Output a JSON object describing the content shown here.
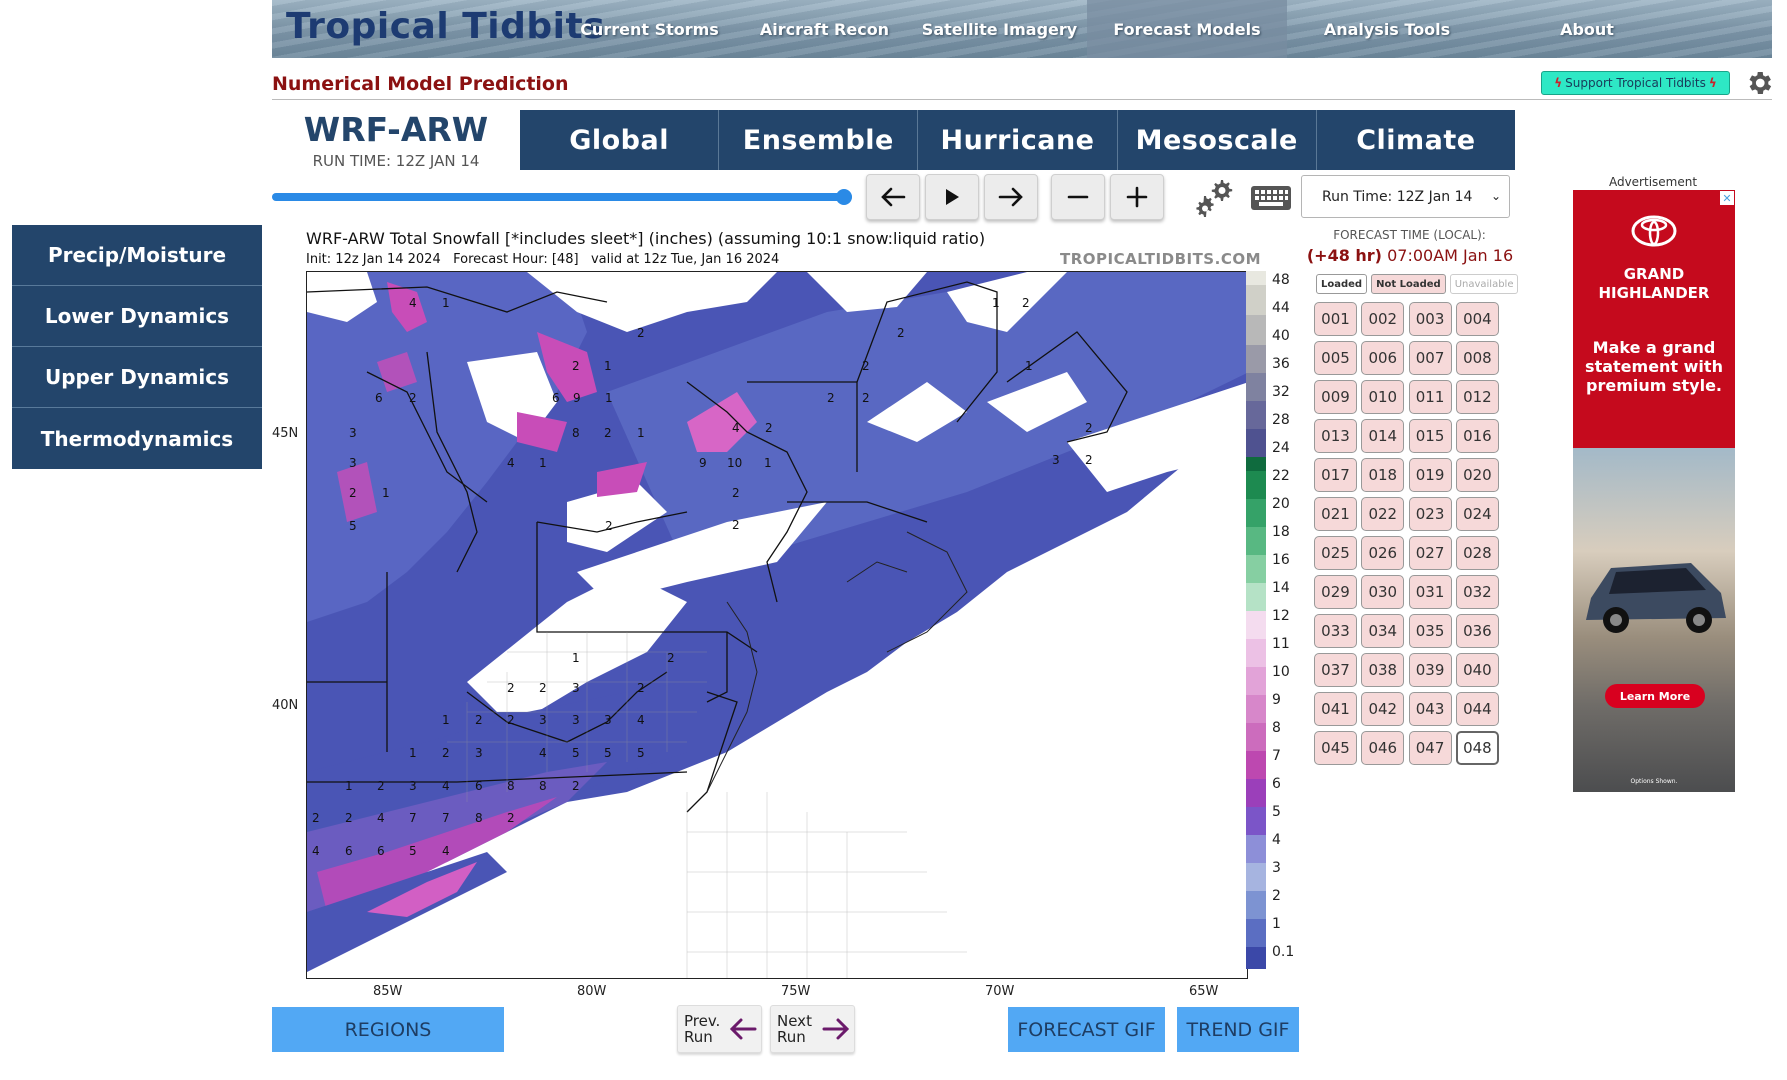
{
  "header": {
    "logo_text": "Tropical Tidbits",
    "nav": [
      "Current Storms",
      "Aircraft Recon",
      "Satellite Imagery",
      "Forecast Models",
      "Analysis Tools",
      "About"
    ],
    "active_nav": "Forecast Models"
  },
  "subtitle": "Numerical Model Prediction",
  "support_label": "Support Tropical Tidbits",
  "model": {
    "name": "WRF-ARW",
    "run_time": "RUN TIME: 12Z JAN 14"
  },
  "category_tabs": [
    "Global",
    "Ensemble",
    "Hurricane",
    "Mesoscale",
    "Climate"
  ],
  "run_select": {
    "value": "Run Time: 12Z Jan 14"
  },
  "sidebar": [
    "Precip/Moisture",
    "Lower Dynamics",
    "Upper Dynamics",
    "Thermodynamics"
  ],
  "map": {
    "title": "WRF-ARW Total Snowfall [*includes sleet*] (inches) (assuming 10:1 snow:liquid ratio)",
    "subtitle": "Init: 12z Jan 14 2024   Forecast Hour: [48]   valid at 12z Tue, Jan 16 2024",
    "watermark": "TROPICALTIDBITS.COM",
    "lat_labels": [
      "45N",
      "40N"
    ],
    "lon_labels": [
      "85W",
      "80W",
      "75W",
      "70W",
      "65W"
    ],
    "colorbar": {
      "labels": [
        "48",
        "44",
        "40",
        "36",
        "32",
        "28",
        "24",
        "22",
        "20",
        "18",
        "16",
        "14",
        "12",
        "11",
        "10",
        "9",
        "8",
        "7",
        "6",
        "5",
        "4",
        "3",
        "2",
        "1",
        "0.1"
      ]
    }
  },
  "forecast": {
    "label": "FORECAST TIME (LOCAL):",
    "offset": "(+48 hr)",
    "time": " 07:00AM Jan 16"
  },
  "status_legend": [
    "Loaded",
    "Not Loaded",
    "Unavailable"
  ],
  "hours": [
    "001",
    "002",
    "003",
    "004",
    "005",
    "006",
    "007",
    "008",
    "009",
    "010",
    "011",
    "012",
    "013",
    "014",
    "015",
    "016",
    "017",
    "018",
    "019",
    "020",
    "021",
    "022",
    "023",
    "024",
    "025",
    "026",
    "027",
    "028",
    "029",
    "030",
    "031",
    "032",
    "033",
    "034",
    "035",
    "036",
    "037",
    "038",
    "039",
    "040",
    "041",
    "042",
    "043",
    "044",
    "045",
    "046",
    "047",
    "048"
  ],
  "current_hour": "048",
  "ad": {
    "label": "Advertisement",
    "brand": "GRAND HIGHLANDER",
    "tagline": "Make a grand statement with premium style.",
    "cta": "Learn More",
    "fine_print": "Options Shown."
  },
  "bottom": {
    "regions": "REGIONS",
    "prev_line1": "Prev.",
    "prev_line2": "Run",
    "next_line1": "Next",
    "next_line2": "Run",
    "forecast_gif": "FORECAST GIF",
    "trend_gif": "TREND GIF"
  },
  "colors": {
    "nav_blue": "#23456b",
    "accent_blue": "#52a8f4",
    "slider_blue": "#2a8ae6",
    "title_red": "#8b1111",
    "snow_light": "#5a6bc4",
    "snow_medium": "#3a47a8",
    "snow_heavy": "#c63db7"
  }
}
